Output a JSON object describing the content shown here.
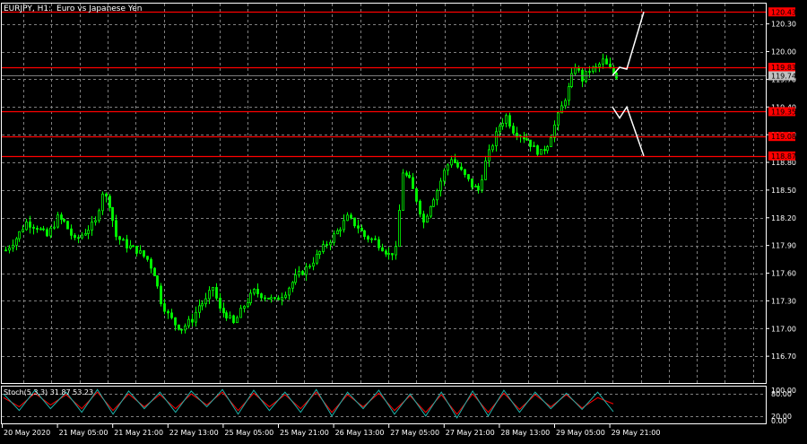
{
  "chart_header": {
    "symbol_timeframe": "EURJPY, H1:",
    "description": "Euro vs Japanese Yen"
  },
  "colors": {
    "background": "#000000",
    "grid": "#7f7f7f",
    "axis_text": "#ffffff",
    "candle": "#00ff00",
    "level_line": "#ff0000",
    "level_label_bg": "#ff0000",
    "bid_line": "#7f7f7f",
    "bid_label_bg": "#c0c0c0",
    "projection": "#ffffff",
    "stoch_main": "#20b2aa",
    "stoch_signal": "#ff0000"
  },
  "price_axis": {
    "ticks": [
      "120.30",
      "120.00",
      "119.70",
      "119.40",
      "119.10",
      "118.80",
      "118.50",
      "118.20",
      "117.90",
      "117.60",
      "117.30",
      "117.00",
      "116.70"
    ]
  },
  "levels": [
    {
      "label": "120.43",
      "price": 120.43
    },
    {
      "label": "119.83",
      "price": 119.83
    },
    {
      "label": "119.35",
      "price": 119.35
    },
    {
      "label": "119.08",
      "price": 119.08
    },
    {
      "label": "118.87",
      "price": 118.87
    }
  ],
  "bid": {
    "label": "119.74",
    "price": 119.74
  },
  "time_axis": {
    "labels": [
      "20 May 2020",
      "21 May 05:00",
      "21 May 21:00",
      "22 May 13:00",
      "25 May 05:00",
      "25 May 21:00",
      "26 May 13:00",
      "27 May 05:00",
      "27 May 21:00",
      "28 May 13:00",
      "29 May 05:00",
      "29 May 21:00"
    ]
  },
  "stochastic": {
    "label": "Stoch(5,3,3) 31.87 53.23",
    "ticks": [
      "100.00",
      "80.00",
      "20.00",
      "0.00"
    ]
  },
  "chart_data": {
    "type": "candlestick",
    "symbol": "EURJPY",
    "timeframe": "H1",
    "ylim": [
      116.41,
      120.52
    ],
    "close_path": [
      [
        0,
        117.85
      ],
      [
        3,
        117.98
      ],
      [
        6,
        118.15
      ],
      [
        9,
        118.1
      ],
      [
        12,
        118.0
      ],
      [
        15,
        118.2
      ],
      [
        17,
        118.15
      ],
      [
        20,
        117.95
      ],
      [
        23,
        118.05
      ],
      [
        26,
        118.15
      ],
      [
        28,
        118.48
      ],
      [
        30,
        118.35
      ],
      [
        32,
        118.0
      ],
      [
        35,
        117.9
      ],
      [
        38,
        117.85
      ],
      [
        41,
        117.75
      ],
      [
        43,
        117.6
      ],
      [
        45,
        117.3
      ],
      [
        47,
        117.15
      ],
      [
        49,
        117.05
      ],
      [
        51,
        117.0
      ],
      [
        54,
        117.1
      ],
      [
        56,
        117.25
      ],
      [
        58,
        117.3
      ],
      [
        60,
        117.45
      ],
      [
        62,
        117.2
      ],
      [
        64,
        117.15
      ],
      [
        66,
        117.05
      ],
      [
        69,
        117.25
      ],
      [
        72,
        117.4
      ],
      [
        75,
        117.35
      ],
      [
        78,
        117.3
      ],
      [
        81,
        117.4
      ],
      [
        84,
        117.55
      ],
      [
        87,
        117.65
      ],
      [
        90,
        117.78
      ],
      [
        93,
        117.92
      ],
      [
        96,
        118.05
      ],
      [
        99,
        118.2
      ],
      [
        102,
        118.1
      ],
      [
        104,
        118.0
      ],
      [
        107,
        117.95
      ],
      [
        109,
        117.88
      ],
      [
        111,
        117.8
      ],
      [
        113,
        117.85
      ],
      [
        115,
        118.7
      ],
      [
        117,
        118.6
      ],
      [
        119,
        118.4
      ],
      [
        121,
        118.15
      ],
      [
        123,
        118.35
      ],
      [
        125,
        118.5
      ],
      [
        127,
        118.7
      ],
      [
        129,
        118.85
      ],
      [
        131,
        118.75
      ],
      [
        133,
        118.65
      ],
      [
        135,
        118.55
      ],
      [
        137,
        118.5
      ],
      [
        139,
        118.8
      ],
      [
        141,
        119.0
      ],
      [
        143,
        119.2
      ],
      [
        145,
        119.3
      ],
      [
        147,
        119.15
      ],
      [
        149,
        119.1
      ],
      [
        151,
        119.05
      ],
      [
        153,
        118.95
      ],
      [
        155,
        118.9
      ],
      [
        157,
        119.0
      ],
      [
        159,
        119.2
      ],
      [
        161,
        119.4
      ],
      [
        163,
        119.6
      ],
      [
        165,
        119.85
      ],
      [
        167,
        119.7
      ],
      [
        169,
        119.8
      ],
      [
        171,
        119.82
      ],
      [
        173,
        119.9
      ],
      [
        175,
        119.8
      ],
      [
        177,
        119.74
      ]
    ],
    "projection": {
      "up": [
        119.74,
        119.83,
        119.81,
        120.43
      ],
      "down": [
        119.4,
        119.28,
        119.4,
        118.87
      ]
    },
    "stoch_main": [
      80,
      35,
      90,
      40,
      85,
      30,
      92,
      25,
      88,
      40,
      85,
      30,
      88,
      45,
      92,
      25,
      90,
      35,
      85,
      30,
      92,
      20,
      85,
      40,
      90,
      25,
      80,
      20,
      85,
      15,
      88,
      20,
      90,
      30,
      85,
      40,
      82,
      38,
      85,
      32
    ],
    "stoch_signal": [
      70,
      45,
      82,
      50,
      78,
      40,
      85,
      35,
      80,
      45,
      78,
      40,
      80,
      50,
      85,
      35,
      82,
      45,
      78,
      40,
      85,
      30,
      78,
      45,
      82,
      35,
      75,
      30,
      78,
      25,
      80,
      30,
      82,
      38,
      78,
      45,
      78,
      42,
      70,
      53
    ]
  }
}
